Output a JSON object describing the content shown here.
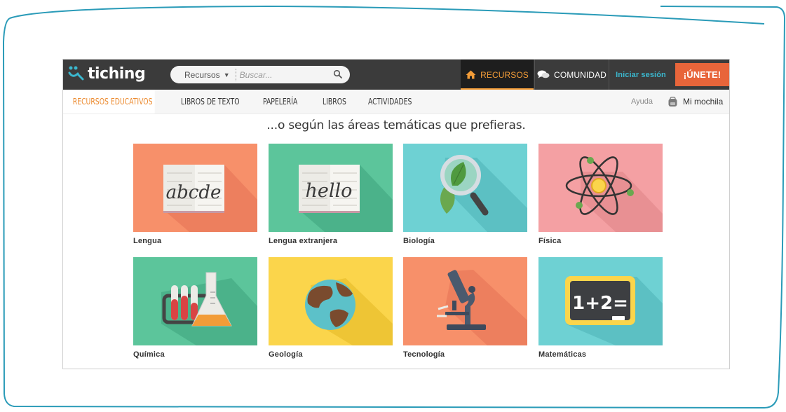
{
  "header": {
    "logo_text": "tiching",
    "search": {
      "type_label": "Recursos",
      "placeholder": "Buscar..."
    },
    "nav": {
      "recursos": "RECURSOS",
      "comunidad": "COMUNIDAD",
      "login": "Iniciar sesión",
      "join": "¡ÚNETE!"
    }
  },
  "subnav": {
    "items": [
      "RECURSOS EDUCATIVOS",
      "LIBROS DE TEXTO",
      "PAPELERÍA",
      "LIBROS",
      "ACTIVIDADES"
    ],
    "active_index": 0,
    "ayuda": "Ayuda",
    "mochila": "Mi mochila"
  },
  "main": {
    "heading": "...o según las áreas temáticas que prefieras.",
    "areas": [
      {
        "label": "Lengua",
        "color": "#f7906a",
        "icon": "book-abcde-icon",
        "book_text": "abcde"
      },
      {
        "label": "Lengua extranjera",
        "color": "#5cc59b",
        "icon": "book-hello-icon",
        "book_text": "hello"
      },
      {
        "label": "Biología",
        "color": "#6ed1d3",
        "icon": "magnifier-leaf-icon"
      },
      {
        "label": "Física",
        "color": "#f4a0a3",
        "icon": "atom-icon"
      },
      {
        "label": "Química",
        "color": "#5cc59b",
        "icon": "test-tubes-flask-icon"
      },
      {
        "label": "Geología",
        "color": "#fbd54b",
        "icon": "globe-icon"
      },
      {
        "label": "Tecnología",
        "color": "#f7906a",
        "icon": "microscope-icon"
      },
      {
        "label": "Matemáticas",
        "color": "#6ed1d3",
        "icon": "blackboard-icon",
        "board_text": "1+2="
      }
    ]
  },
  "colors": {
    "accent_orange": "#f29c38",
    "join_button": "#e8653a",
    "login_blue": "#3bb8cf",
    "frame": "#2a9bb8"
  }
}
